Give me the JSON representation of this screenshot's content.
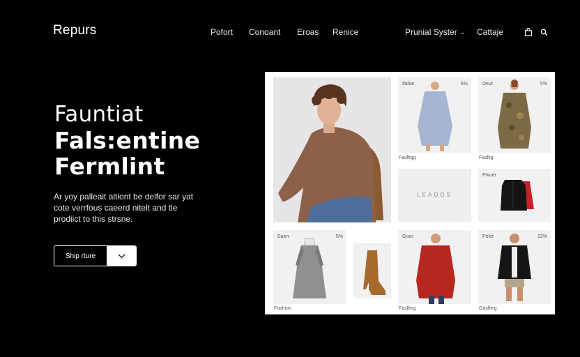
{
  "header": {
    "brand": "Repurs",
    "nav": [
      "Pofort",
      "Conoant",
      "Eroas",
      "Renice"
    ],
    "nav_right": {
      "dropdown_label": "Prunial Syster",
      "link": "Cattaje"
    },
    "icons": [
      "bag-icon",
      "search-icon"
    ]
  },
  "hero": {
    "title_line1": "Fauntiat",
    "title_line2": "Fals:entine",
    "title_line3": "Fermlint",
    "body_line1": "Ar yoy palleait altiont be delfor sar yat",
    "body_line2": "cote verrfous caeerd nitelt and tle",
    "body_line3": "prodiict to this strsne.",
    "cta_label": "Ship rture"
  },
  "products": {
    "featured": {
      "alt": "model in brown sweater"
    },
    "tile_shirt": {
      "label": "Ifaloe",
      "price": "5%",
      "caption": "Faslfigg"
    },
    "tile_coat_camo": {
      "label": "Deur",
      "price": "5%",
      "caption": "Faslfig"
    },
    "tile_leads": {
      "text": "LEADOS"
    },
    "tile_jacket": {
      "label": "Pwuer"
    },
    "tile_dress": {
      "label": "Eaen",
      "price": "5%",
      "caption": "Fashion"
    },
    "tile_red_coat": {
      "label": "Goor",
      "caption": "Faslfieg"
    },
    "tile_black_jacket": {
      "label": "Pelor",
      "price": "13%",
      "caption": "Oaslfieg"
    }
  },
  "colors": {
    "background": "#000000",
    "panel": "#ffffff",
    "accent_text": "#ffffff"
  }
}
